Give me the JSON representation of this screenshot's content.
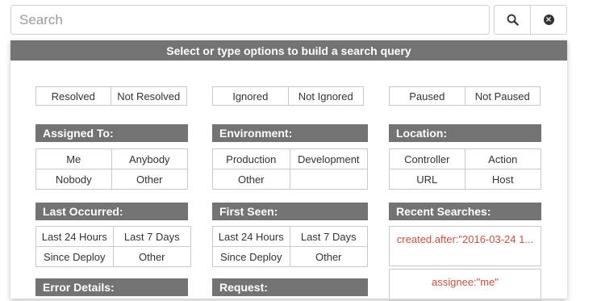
{
  "search": {
    "placeholder": "Search",
    "value": "",
    "search_icon": "search-icon",
    "clear_icon": "clear-icon"
  },
  "panel": {
    "header": "Select or type options to build a search query"
  },
  "toggles": [
    {
      "on": "Resolved",
      "off": "Not Resolved"
    },
    {
      "on": "Ignored",
      "off": "Not Ignored"
    },
    {
      "on": "Paused",
      "off": "Not Paused"
    }
  ],
  "sections": {
    "assigned_to": {
      "title": "Assigned To:",
      "options": [
        "Me",
        "Anybody",
        "Nobody",
        "Other"
      ]
    },
    "environment": {
      "title": "Environment:",
      "options": [
        "Production",
        "Development",
        "Other",
        ""
      ]
    },
    "location": {
      "title": "Location:",
      "options": [
        "Controller",
        "Action",
        "URL",
        "Host"
      ]
    },
    "last_occurred": {
      "title": "Last Occurred:",
      "options": [
        "Last 24 Hours",
        "Last 7 Days",
        "Since Deploy",
        "Other"
      ]
    },
    "first_seen": {
      "title": "First Seen:",
      "options": [
        "Last 24 Hours",
        "Last 7 Days",
        "Since Deploy",
        "Other"
      ]
    },
    "recent_searches": {
      "title": "Recent Searches:",
      "items": [
        "created.after:\"2016-03-24 1...",
        "assignee:\"me\""
      ]
    },
    "error_details": {
      "title": "Error Details:"
    },
    "request": {
      "title": "Request:"
    }
  },
  "colors": {
    "header_bg": "#737373",
    "recent_link": "#c0533f"
  }
}
